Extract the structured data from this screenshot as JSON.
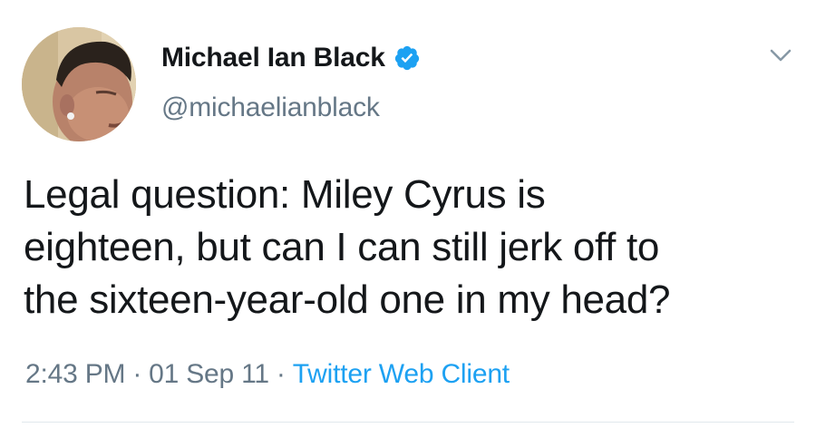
{
  "tweet": {
    "display_name": "Michael Ian Black",
    "handle": "@michaelianblack",
    "text_lines": [
      "Legal question: Miley Cyrus is",
      "eighteen, but can I can still jerk off to",
      "the sixteen-year-old one in my head?"
    ],
    "time": "2:43 PM",
    "separator": "·",
    "date": "01 Sep 11",
    "client": "Twitter Web Client"
  },
  "icons": {
    "verified": "verified-badge-icon",
    "caret": "chevron-down-icon"
  },
  "colors": {
    "text": "#14171a",
    "secondary": "#657786",
    "accent": "#1da1f2",
    "divider": "#e1e8ed"
  }
}
